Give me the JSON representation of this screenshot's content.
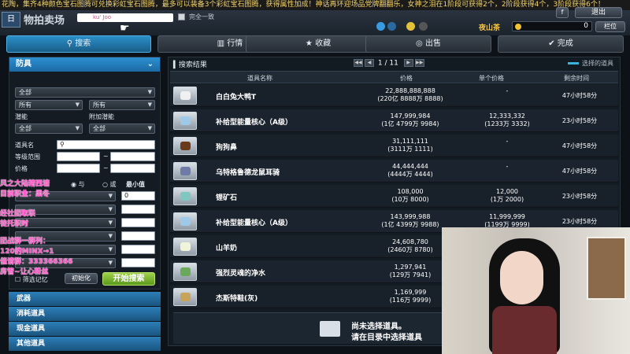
{
  "marquee": "花陶，集齐4种颜色宝石图腾可兑换彩虹宝石图腾，最多可以装备3个彩虹宝石图腾，获得属性加成！神话再环迎场品党牌翻翻乐，女神之泪在1阶段可获得2个，2阶段获得4个，3阶段获得6个！",
  "header": {
    "title_fragment": "物拍卖场",
    "logo_text": "日",
    "search_value": "ku' Joo",
    "exact_match_label": "完全一致",
    "uid": "7774830",
    "server_name": "夜山茶",
    "gold_value": "0",
    "mailbox_label": "栏位",
    "exit_label": "退出",
    "help_label": "f"
  },
  "tabs": [
    {
      "label": "搜索",
      "icon": "search-icon"
    },
    {
      "label": "行情",
      "icon": "chart-icon"
    },
    {
      "label": "收藏",
      "icon": "star-icon"
    },
    {
      "label": "出售",
      "icon": "coin-icon"
    },
    {
      "label": "完成",
      "icon": "check-icon"
    }
  ],
  "filters": {
    "category": "防具",
    "type_all": "全部",
    "owner_1": "所有",
    "owner_2": "所有",
    "potential_label": "潜能",
    "extra_potential_label": "附加潜能",
    "potential_value": "全部",
    "extra_potential_value": "全部",
    "item_name_label": "道具名",
    "level_range_label": "等级范围",
    "price_label": "价格",
    "and_label": "与",
    "or_label": "或",
    "min_label": "最小值",
    "min_value": "0",
    "filter_memory_label": "筛选记忆",
    "reset_label": "初始化",
    "search_button": "开始搜索",
    "dash": "~"
  },
  "overlay_text": {
    "line1": "风之大陆精西塘",
    "line2": "目前职业：黑冬",
    "line3": "经社团取联",
    "line4": "徒托职时",
    "line5": "团战群一群列：",
    "line6": "120的MINX→1",
    "line7": "催请群：333366366",
    "line8": "房管~让心粉丝"
  },
  "categories": [
    "武器",
    "消耗道具",
    "现金道具",
    "其他道具"
  ],
  "results": {
    "title": "搜索结果",
    "page_current": "1",
    "page_total": "11",
    "selected_legend": "选择的道具",
    "columns": [
      "道具名称",
      "价格",
      "单个价格",
      "剩余时间"
    ],
    "rows": [
      {
        "name": "白白兔大鸭T",
        "price": "22,888,888,888",
        "price_sub": "(220亿 8888万 8888)",
        "unit": "-",
        "unit_sub": "",
        "time": "47小时58分"
      },
      {
        "name": "补给型能量核心（A级）",
        "price": "147,999,984",
        "price_sub": "(1亿 4799万 9984)",
        "unit": "12,333,332",
        "unit_sub": "(1233万 3332)",
        "time": "23小时58分"
      },
      {
        "name": "狗狗鼻",
        "price": "31,111,111",
        "price_sub": "(3111万 1111)",
        "unit": "-",
        "unit_sub": "",
        "time": "47小时58分"
      },
      {
        "name": "乌特格鲁德龙鼠耳骑",
        "price": "44,444,444",
        "price_sub": "(4444万 4444)",
        "unit": "-",
        "unit_sub": "",
        "time": "47小时58分"
      },
      {
        "name": "锂矿石",
        "price": "108,000",
        "price_sub": "(10万 8000)",
        "unit": "12,000",
        "unit_sub": "(1万 2000)",
        "time": "23小时58分"
      },
      {
        "name": "补给型能量核心（A级）",
        "price": "143,999,988",
        "price_sub": "(1亿 4399万 9988)",
        "unit": "11,999,999",
        "unit_sub": "(1199万 9999)",
        "time": "23小时58分"
      },
      {
        "name": "山羊奶",
        "price": "24,608,780",
        "price_sub": "(2460万 8780)",
        "unit": "",
        "unit_sub": "",
        "time": ""
      },
      {
        "name": "强烈灵魂的净水",
        "price": "1,297,941",
        "price_sub": "(129万 7941)",
        "unit": "",
        "unit_sub": "",
        "time": ""
      },
      {
        "name": "杰斯特鞋(灰)",
        "price": "1,169,999",
        "price_sub": "(116万 9999)",
        "unit": "",
        "unit_sub": "",
        "time": ""
      }
    ],
    "empty_title": "尚未选择道具。",
    "empty_hint": "请在目录中选择道具"
  },
  "colors": {
    "accent": "#2a8fc8",
    "gold": "#f5c54a",
    "overlay_pink": "#ff54c7"
  }
}
